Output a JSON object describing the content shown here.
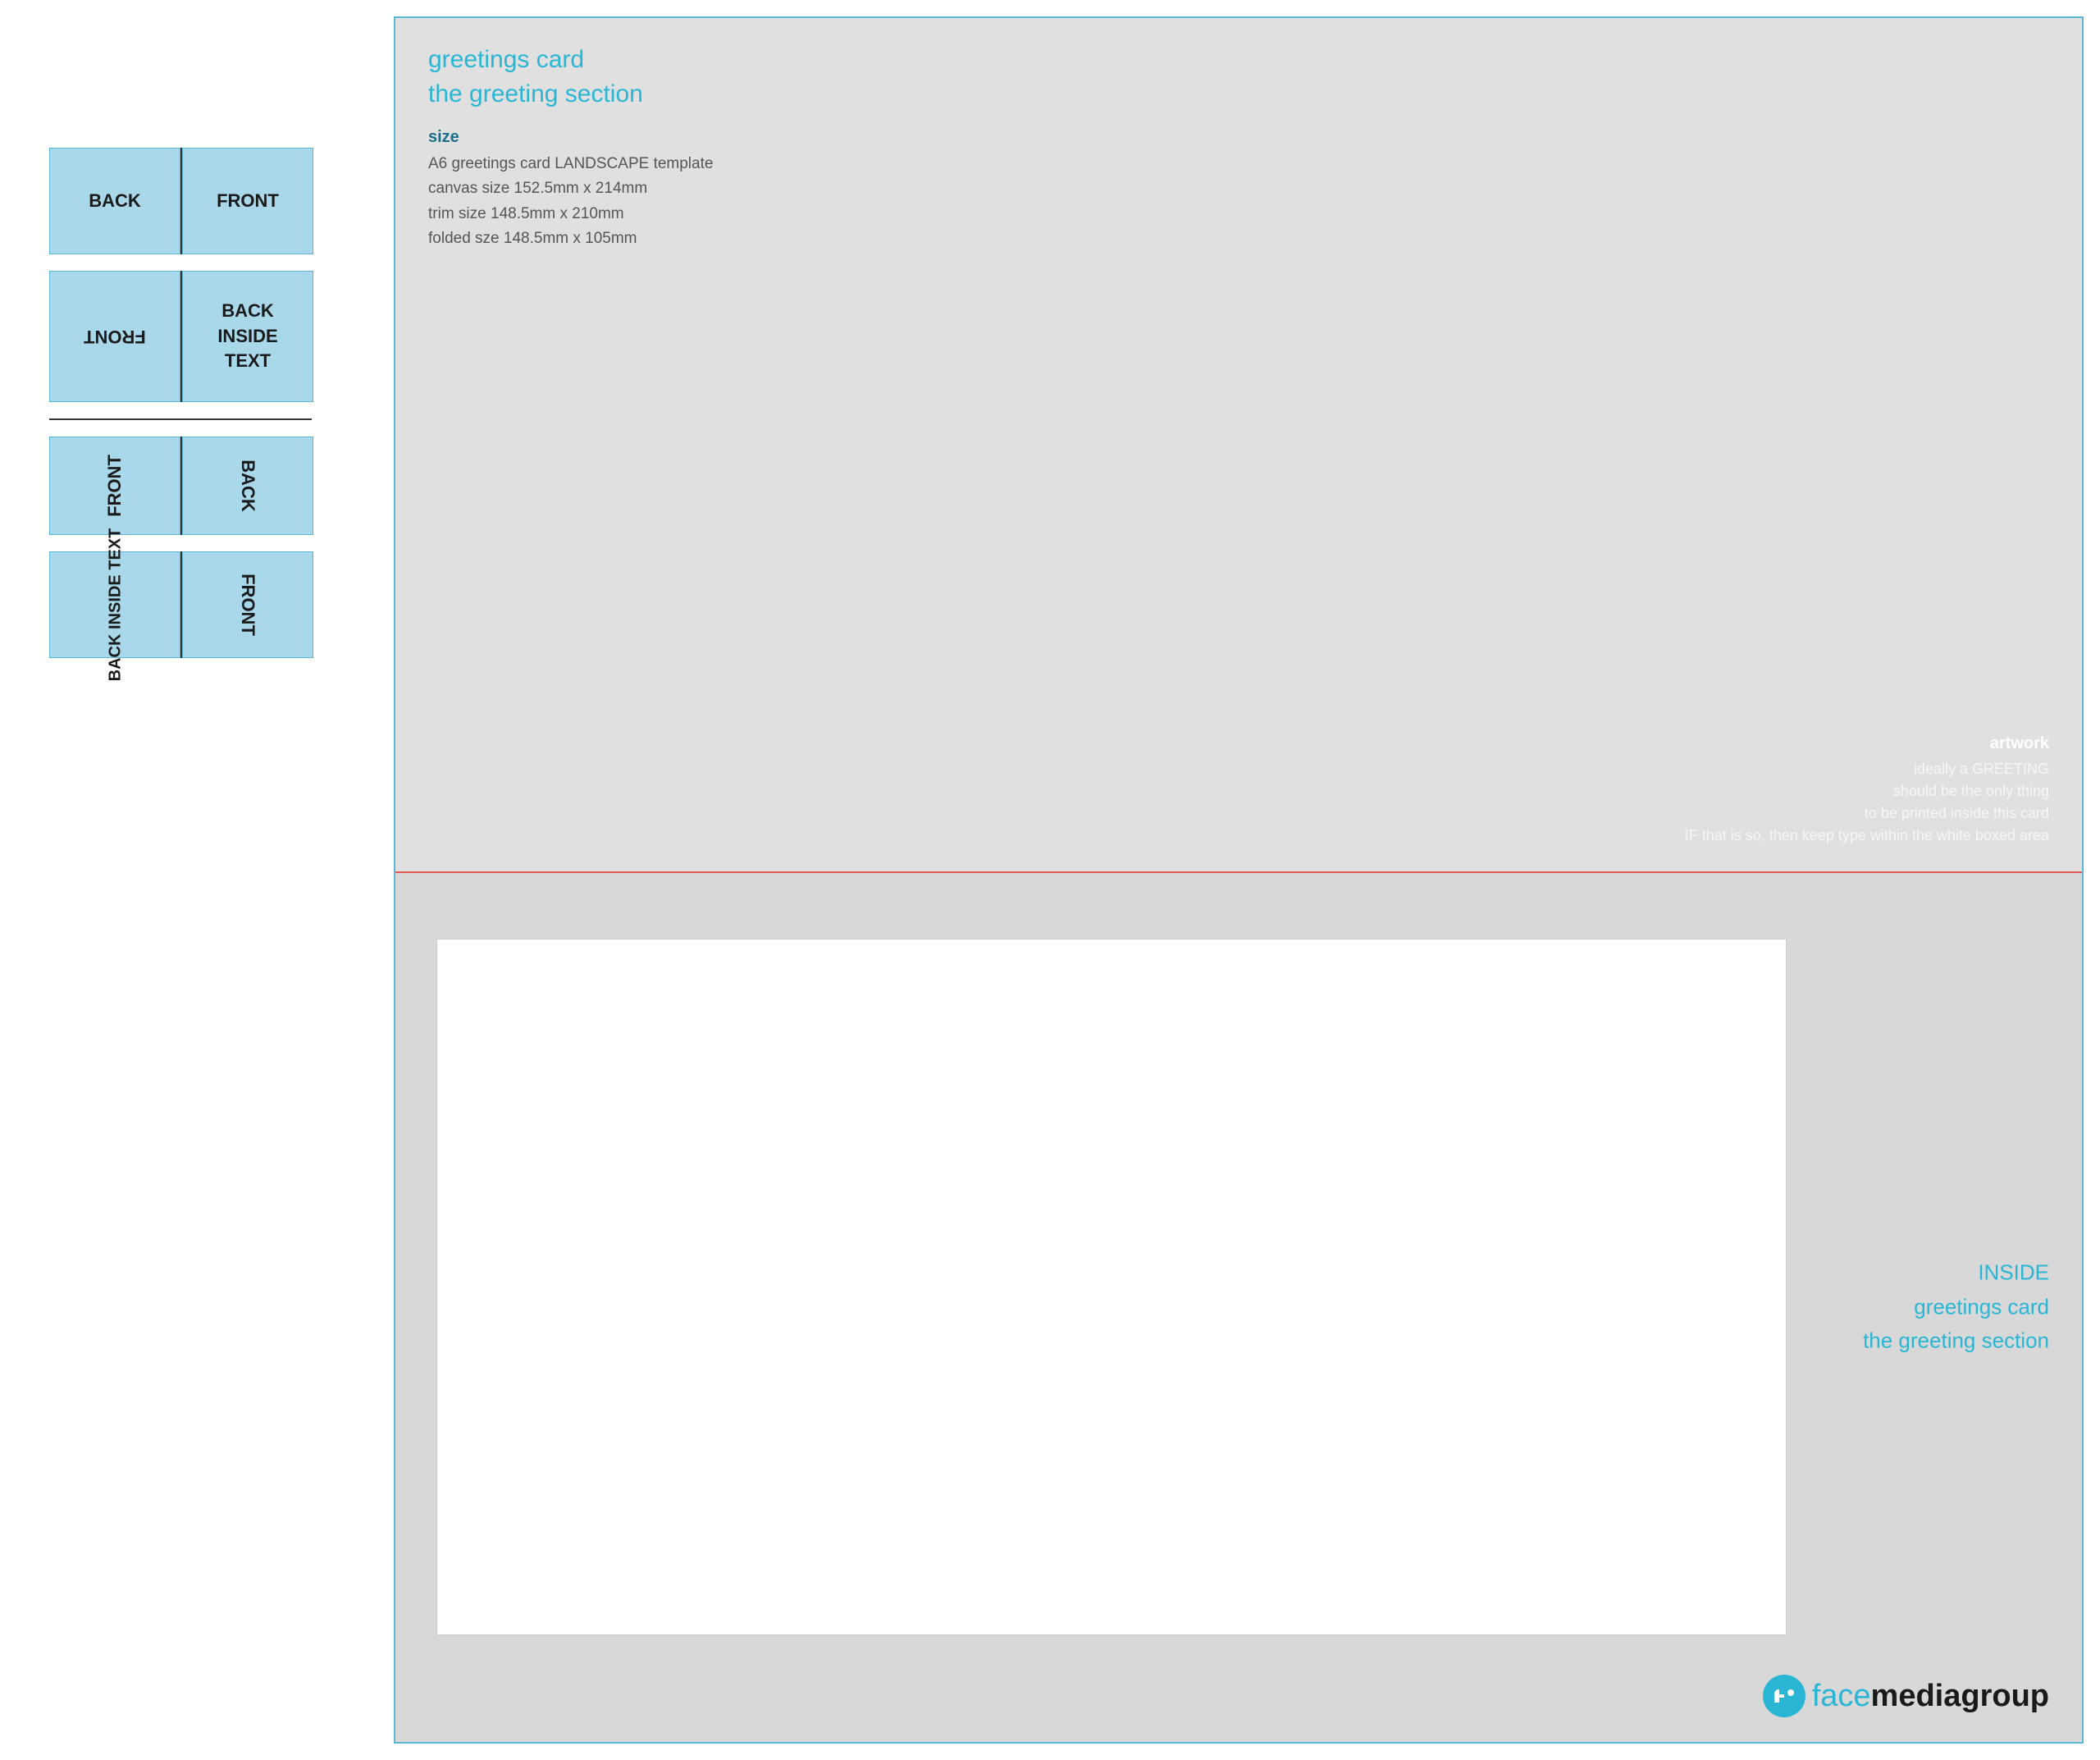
{
  "leftPanel": {
    "row1": {
      "back_label": "BACK",
      "front_label": "FRONT"
    },
    "row2": {
      "flipped_front": "FRONT",
      "back_inside_line1": "BACK",
      "back_inside_line2": "INSIDE",
      "back_inside_line3": "TEXT"
    },
    "row3": {
      "front_rotated": "FRONT",
      "back_rotated": "BACK"
    },
    "row4": {
      "back_inside_text_rotated": "BACK INSIDE TEXT",
      "front_rotated": "FRONT"
    }
  },
  "rightPanel": {
    "top": {
      "title_line1": "greetings card",
      "title_line2": "the greeting section",
      "size_label": "size",
      "size_line1": "A6 greetings card LANDSCAPE template",
      "size_line2": "canvas size 152.5mm x 214mm",
      "size_line3": "trim size 148.5mm x 210mm",
      "size_line4": "folded sze 148.5mm x 105mm",
      "artwork_title": "artwork",
      "artwork_line1": "ideally a GREETING",
      "artwork_line2": "should be the only thing",
      "artwork_line3": "to be printed inside this card",
      "artwork_line4": "IF that is so, then keep type within the white boxed area"
    },
    "bottom": {
      "inside_line1": "INSIDE",
      "inside_line2": "greetings card",
      "inside_line3": "the greeting section",
      "logo_text_part1": "face",
      "logo_text_part2": "mediagroup"
    }
  }
}
